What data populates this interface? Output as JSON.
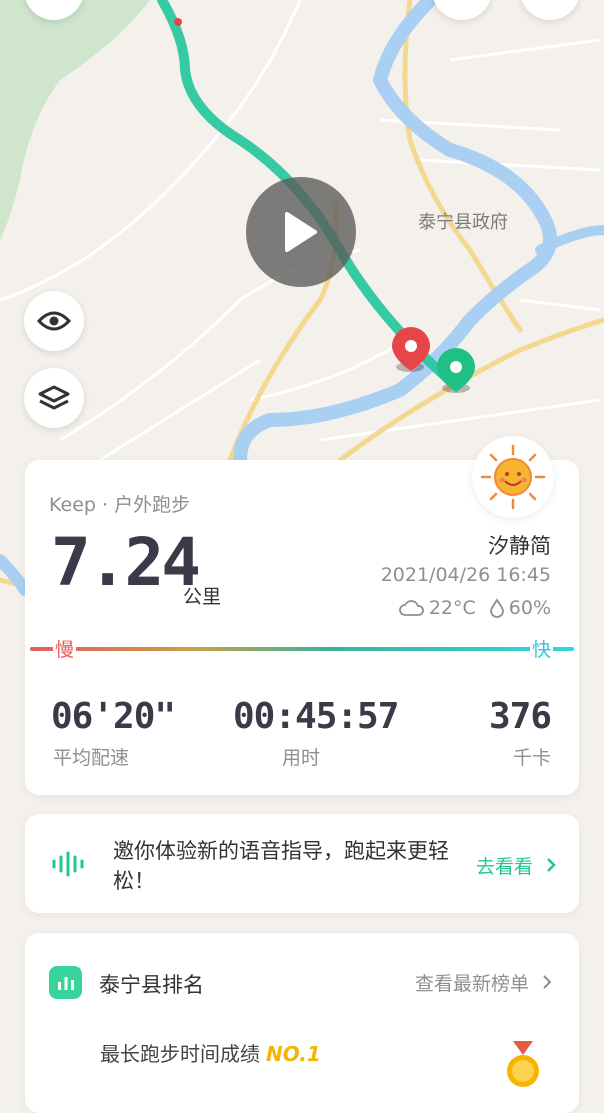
{
  "map": {
    "place_label": "泰宁县政府",
    "route_color": "#21c59b",
    "start_marker_color": "#e8454b",
    "end_marker_color": "#1fbf86"
  },
  "map_controls": {
    "visibility_icon": "eye-icon",
    "layers_icon": "layers-icon",
    "play_icon": "play-icon"
  },
  "workout": {
    "source": "Keep · 户外跑步",
    "distance": "7.24",
    "distance_unit": "公里",
    "user_name": "汐静简",
    "datetime": "2021/04/26 16:45",
    "temperature": "22°C",
    "humidity": "60%",
    "slow_label": "慢",
    "fast_label": "快",
    "stats": [
      {
        "value": "06'20\"",
        "label": "平均配速"
      },
      {
        "value": "00:45:57",
        "label": "用时"
      },
      {
        "value": "376",
        "label": "千卡"
      }
    ]
  },
  "promo": {
    "text": "邀你体验新的语音指导，跑起来更轻松！",
    "link": "去看看",
    "accent": "#24c789"
  },
  "ranking": {
    "title": "泰宁县排名",
    "link": "查看最新榜单",
    "item_text": "最长跑步时间成绩",
    "item_rank": "NO.1"
  }
}
